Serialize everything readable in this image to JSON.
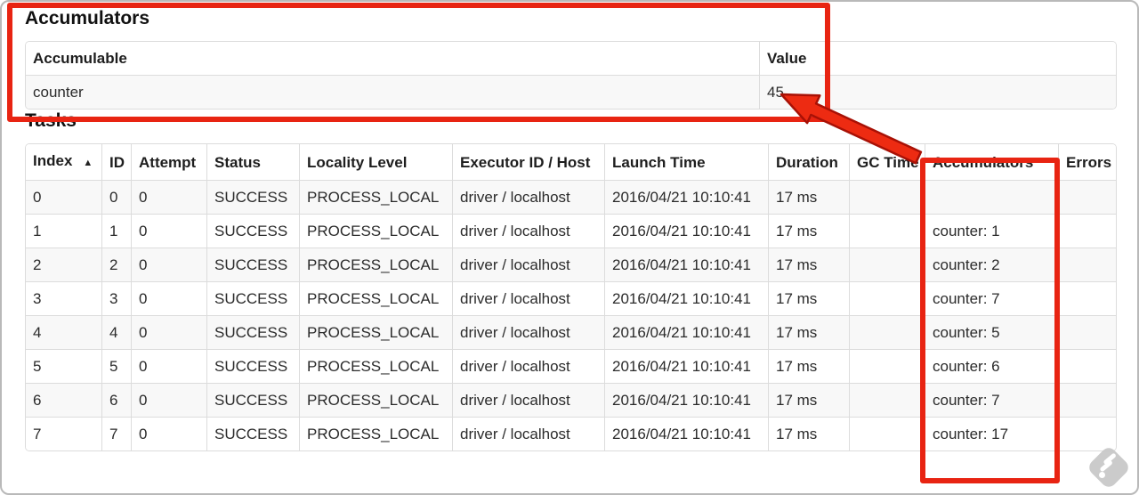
{
  "accumulators": {
    "title": "Accumulators",
    "headers": [
      "Accumulable",
      "Value"
    ],
    "row": {
      "name": "counter",
      "value": "45"
    }
  },
  "tasks": {
    "title": "Tasks",
    "sort_icon": "▲",
    "headers": [
      "Index",
      "ID",
      "Attempt",
      "Status",
      "Locality Level",
      "Executor ID / Host",
      "Launch Time",
      "Duration",
      "GC Time",
      "Accumulators",
      "Errors"
    ],
    "rows": [
      [
        "0",
        "0",
        "0",
        "SUCCESS",
        "PROCESS_LOCAL",
        "driver / localhost",
        "2016/04/21 10:10:41",
        "17 ms",
        "",
        "",
        ""
      ],
      [
        "1",
        "1",
        "0",
        "SUCCESS",
        "PROCESS_LOCAL",
        "driver / localhost",
        "2016/04/21 10:10:41",
        "17 ms",
        "",
        "counter: 1",
        ""
      ],
      [
        "2",
        "2",
        "0",
        "SUCCESS",
        "PROCESS_LOCAL",
        "driver / localhost",
        "2016/04/21 10:10:41",
        "17 ms",
        "",
        "counter: 2",
        ""
      ],
      [
        "3",
        "3",
        "0",
        "SUCCESS",
        "PROCESS_LOCAL",
        "driver / localhost",
        "2016/04/21 10:10:41",
        "17 ms",
        "",
        "counter: 7",
        ""
      ],
      [
        "4",
        "4",
        "0",
        "SUCCESS",
        "PROCESS_LOCAL",
        "driver / localhost",
        "2016/04/21 10:10:41",
        "17 ms",
        "",
        "counter: 5",
        ""
      ],
      [
        "5",
        "5",
        "0",
        "SUCCESS",
        "PROCESS_LOCAL",
        "driver / localhost",
        "2016/04/21 10:10:41",
        "17 ms",
        "",
        "counter: 6",
        ""
      ],
      [
        "6",
        "6",
        "0",
        "SUCCESS",
        "PROCESS_LOCAL",
        "driver / localhost",
        "2016/04/21 10:10:41",
        "17 ms",
        "",
        "counter: 7",
        ""
      ],
      [
        "7",
        "7",
        "0",
        "SUCCESS",
        "PROCESS_LOCAL",
        "driver / localhost",
        "2016/04/21 10:10:41",
        "17 ms",
        "",
        "counter: 17",
        ""
      ]
    ]
  },
  "annotations": {
    "box_color": "#e82412",
    "arrow_fill": "#ed2b12",
    "arrow_outline": "#a81106"
  }
}
